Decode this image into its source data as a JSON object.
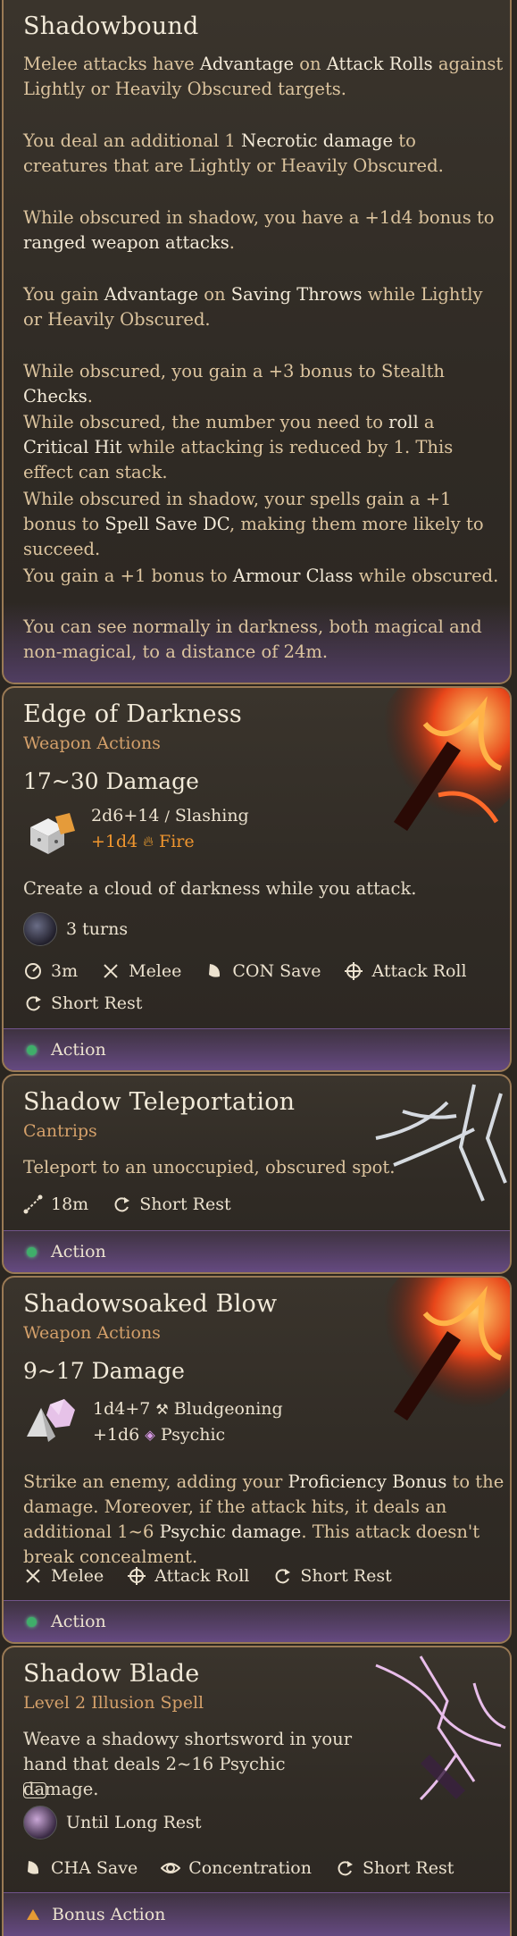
{
  "shadowbound": {
    "title": "Shadowbound",
    "p1_a": "Melee attacks have ",
    "p1_b": "Advantage",
    "p1_c": " on ",
    "p1_d": "Attack Rolls",
    "p1_e": " against Lightly or Heavily Obscured targets.",
    "p2_a": "You deal an additional 1 ",
    "p2_b": "Necrotic damage",
    "p2_c": " to creatures that are Lightly or Heavily Obscured.",
    "p3_a": "While obscured in shadow, you have a +1d4 bonus to ",
    "p3_b": "ranged weapon attacks",
    "p3_c": ".",
    "p4_a": "You gain ",
    "p4_b": "Advantage",
    "p4_c": " on ",
    "p4_d": "Saving Throws",
    "p4_e": " while Lightly or Heavily Obscured.",
    "p5_a": "While obscured, you gain a +3 bonus to Stealth ",
    "p5_b": "Checks",
    "p5_c": ".",
    "p6_a": "While obscured, the number you need to ",
    "p6_b": "roll",
    "p6_c": " a ",
    "p6_d": "Critical Hit",
    "p6_e": " while attacking is reduced by 1. This effect can stack.",
    "p7_a": "While obscured in shadow, your spells gain a +1 bonus to ",
    "p7_b": "Spell Save DC",
    "p7_c": ", making them more likely to succeed.",
    "p8_a": "You gain a +1 bonus to ",
    "p8_b": "Armour Class",
    "p8_c": " while obscured.",
    "p9": "You can see normally in darkness, both magical and non-magical, to a distance of 24m."
  },
  "edge_of_darkness": {
    "title": "Edge of Darkness",
    "subtitle": "Weapon Actions",
    "damage": "17~30 Damage",
    "dice1": "2d6+14",
    "type1": "Slashing",
    "dice2": "+1d4",
    "type2": "Fire",
    "description": "Create a cloud of darkness while you attack.",
    "turns": "3 turns",
    "range": "3m",
    "melee": "Melee",
    "save": "CON Save",
    "attack": "Attack Roll",
    "rest": "Short Rest",
    "action": "Action"
  },
  "shadow_teleportation": {
    "title": "Shadow Teleportation",
    "subtitle": "Cantrips",
    "description": "Teleport to an unoccupied, obscured spot.",
    "range": "18m",
    "rest": "Short Rest",
    "action": "Action"
  },
  "shadowsoaked_blow": {
    "title": "Shadowsoaked Blow",
    "subtitle": "Weapon Actions",
    "damage": "9~17 Damage",
    "dice1": "1d4+7",
    "type1": "Bludgeoning",
    "dice2": "+1d6",
    "type2": "Psychic",
    "desc_a": "Strike an enemy, adding your ",
    "desc_b": "Proficiency Bonus",
    "desc_c": " to the damage. Moreover, if the attack hits, it deals an additional 1~6 ",
    "desc_d": "Psychic damage",
    "desc_e": ". This attack doesn't break concealment.",
    "melee": "Melee",
    "attack": "Attack Roll",
    "rest": "Short Rest",
    "action": "Action"
  },
  "shadow_blade": {
    "title": "Shadow Blade",
    "subtitle": "Level 2 Illusion Spell",
    "description": "Weave a shadowy shortsword in your hand that deals 2~16 Psychic damage.",
    "ellipsis": "...",
    "duration": "Until Long Rest",
    "save": "CHA Save",
    "concentration": "Concentration",
    "rest": "Short Rest",
    "action": "Bonus Action"
  },
  "colors": {
    "border": "#9a7a55",
    "subtitle": "#d4a06a",
    "body_text": "#dcc49e",
    "highlight": "#f3ead8",
    "fire": "#f0962e",
    "action_dot": "#3fae6a",
    "bonus_triangle": "#e69a34"
  },
  "icons": [
    "range-icon",
    "melee-icon",
    "save-icon",
    "attack-roll-icon",
    "short-rest-icon",
    "slashing-icon",
    "fire-icon",
    "bludgeoning-icon",
    "psychic-icon",
    "teleport-range-icon",
    "concentration-icon"
  ]
}
